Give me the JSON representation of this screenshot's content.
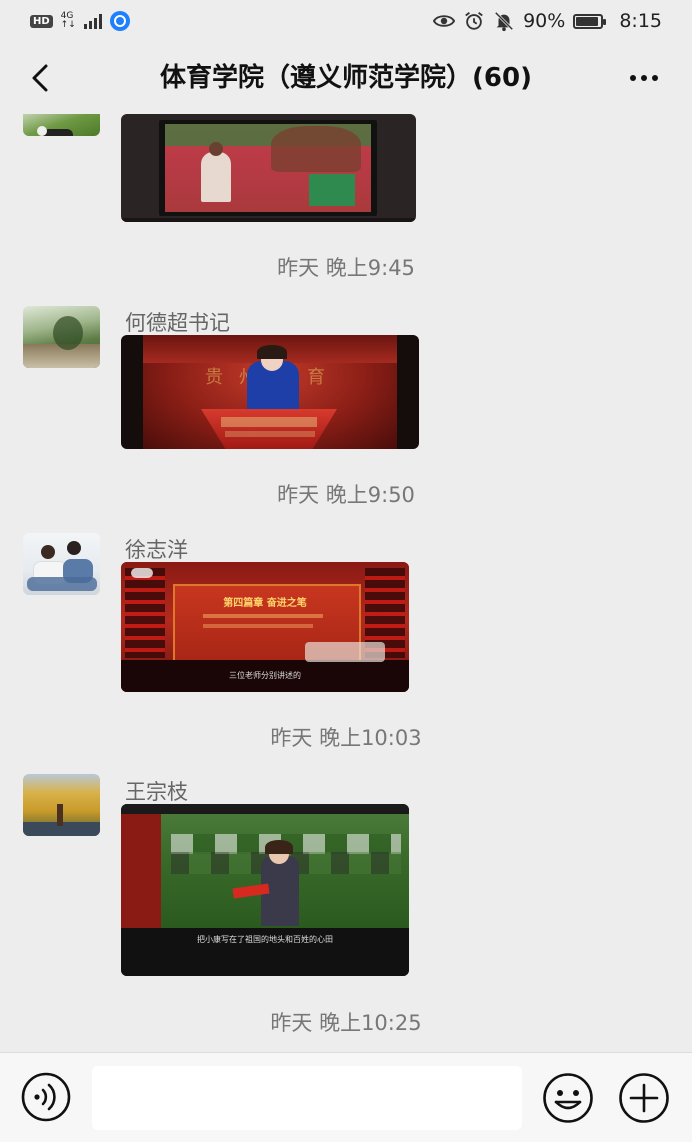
{
  "status_bar": {
    "hd": "HD",
    "network": "4G",
    "battery": "90%",
    "battery_level": 0.9,
    "time": "8:15",
    "icons": [
      "eye-icon",
      "alarm-icon",
      "mute-icon",
      "battery-icon"
    ]
  },
  "header": {
    "title": "体育学院（遵义师范学院）(60)",
    "back_icon": "chevron-left-icon",
    "more_icon": "more-dots-icon"
  },
  "messages": [
    {
      "timestamp": "昨天 晚上9:45"
    },
    {
      "sender": "何德超书记",
      "timestamp": "昨天 晚上9:50",
      "video_caption": "贵州教育"
    },
    {
      "sender": "徐志洋",
      "timestamp": "昨天 晚上10:03",
      "video_caption": "第四篇章 奋进之笔",
      "video_subtitle": "三位老师分别讲述的"
    },
    {
      "sender": "王宗枝",
      "timestamp": "昨天 晚上10:25",
      "video_subtitle": "把小康写在了祖国的地头和百姓的心田"
    }
  ],
  "input_bar": {
    "placeholder": "",
    "voice_icon": "voice-icon",
    "emoji_icon": "emoji-icon",
    "plus_icon": "plus-icon"
  }
}
